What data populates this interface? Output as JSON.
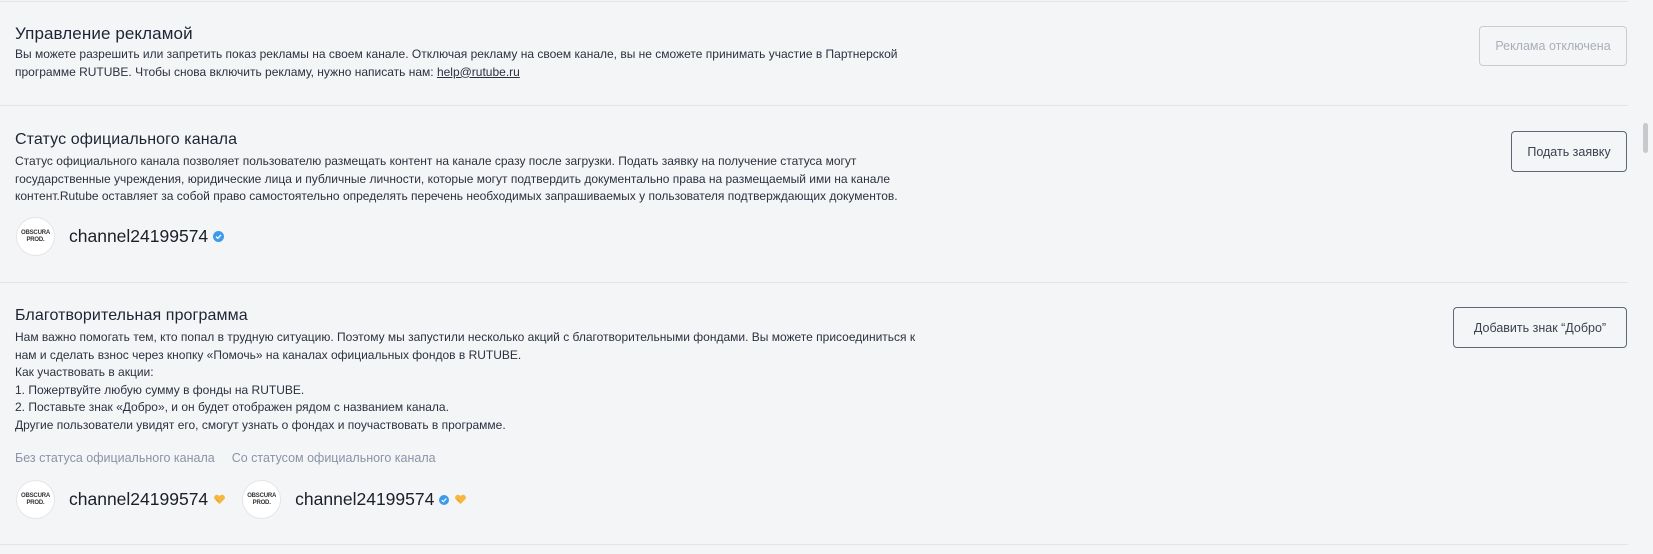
{
  "ads": {
    "title": "Управление рекламой",
    "desc_line1": "Вы можете разрешить или запретить показ рекламы на своем канале. Отключая рекламу на своем канале, вы не сможете принимать участие в Партнерской",
    "desc_line2_prefix": "программе RUTUBE. Чтобы снова включить рекламу, нужно написать нам: ",
    "email": "help@rutube.ru",
    "button": "Реклама отключена"
  },
  "official": {
    "title": "Статус официального канала",
    "desc_line1": "Статус официального канала позволяет пользователю размещать контент на канале сразу после загрузки. Подать заявку на получение статуса могут",
    "desc_line2": "государственные учреждения, юридические лица и публичные личности, которые могут подтвердить документально права на размещаемый ими на канале",
    "desc_line3": "контент.Rutube оставляет за собой право самостоятельно определять перечень необходимых запрашиваемых у пользователя подтверждающих документов.",
    "button": "Подать заявку",
    "channel_name": "channel24199574",
    "avatar_line1": "OBSCURA",
    "avatar_line2": "PROD."
  },
  "charity": {
    "title": "Благотворительная программа",
    "desc_lines": [
      "Нам важно помогать тем, кто попал в трудную ситуацию. Поэтому мы запустили несколько акций с благотворительными фондами. Вы можете присоединиться к",
      "нам и сделать взнос через кнопку «Помочь» на каналах официальных фондов в RUTUBE.",
      "Как участвовать в акции:",
      "1. Пожертвуйте любую сумму в фонды на RUTUBE.",
      "2. Поставьте знак «Добро», и он будет отображен рядом с названием канала.",
      "Другие пользователи увидят его, смогут узнать о фондах и поучаствовать в программе."
    ],
    "button": "Добавить знак “Добро”",
    "tab_without": "Без статуса официального канала",
    "tab_with": "Со статусом официального канала",
    "channel_name": "channel24199574",
    "avatar_line1": "OBSCURA",
    "avatar_line2": "PROD."
  },
  "colors": {
    "verify": "#3d9be9",
    "heart": "#f5b740"
  }
}
